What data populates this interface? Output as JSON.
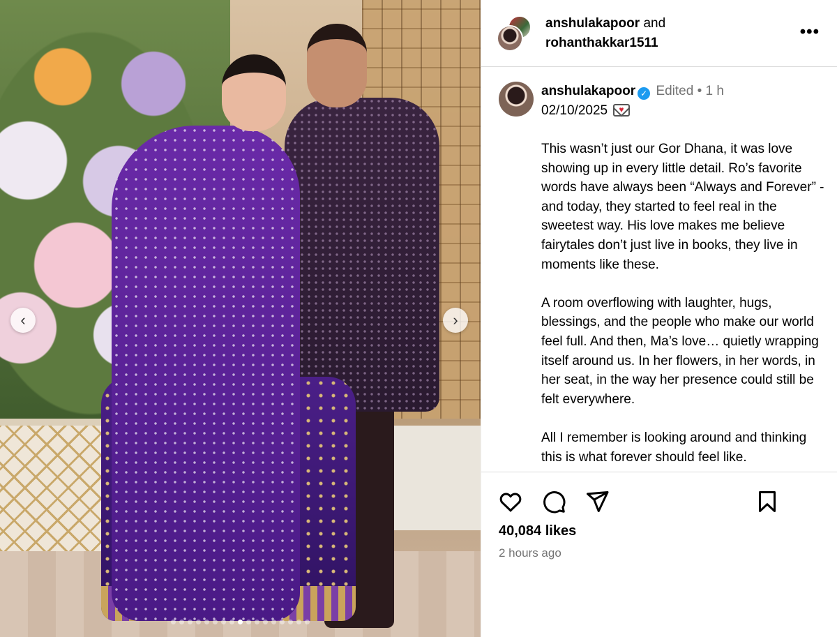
{
  "post": {
    "header": {
      "user1": "anshulakapoor",
      "conjunction": "and",
      "user2": "rohanthakkar1511",
      "more_label": "•••"
    },
    "author": {
      "username": "anshulakapoor",
      "verified_icon": "verified-badge-icon",
      "edited_label": "Edited",
      "separator": "•",
      "age": "1 h",
      "date_line": "02/10/2025"
    },
    "caption_paragraphs": [
      "This wasn’t just our Gor Dhana, it was love showing up in every little detail. Ro’s favorite words have always been “Always and Forever” - and today, they started to feel real in the sweetest way. His love makes me believe fairytales don’t just live in books, they live in moments like these.",
      "A room overflowing with laughter, hugs, blessings, and the people who make our world feel full. And then, Ma’s love… quietly wrapping itself around us. In her flowers, in her words, in her seat, in the way her presence could still be felt everywhere.",
      "All I remember is looking around and thinking this is what forever should feel like."
    ],
    "likes": "40,084 likes",
    "timestamp": "2 hours ago"
  },
  "carousel": {
    "prev_icon": "chevron-left-icon",
    "next_icon": "chevron-right-icon",
    "slide_count": 17,
    "active_index": 8
  },
  "actions": {
    "icons": [
      "heart-icon",
      "comment-icon",
      "share-icon",
      "bookmark-icon"
    ]
  },
  "colors": {
    "verified": "#1d9bf0",
    "muted_text": "#737373",
    "divider": "#dbdbdb"
  }
}
